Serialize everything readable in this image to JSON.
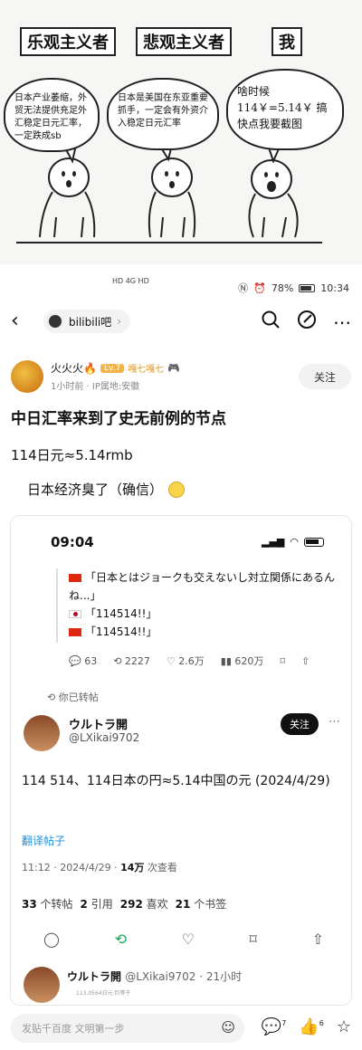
{
  "comic": {
    "labels": [
      "乐观主义者",
      "悲观主义者",
      "我"
    ],
    "bubbles": [
      "日本产业萎缩，外贸无法提供充足外汇稳定日元汇率，一定跌成sb",
      "日本是美国在东亚重要抓手，一定会有外资介入稳定日元汇率",
      "啥时候 114￥=5.14￥ 搞快点我要截图"
    ]
  },
  "status_bar": {
    "left": "HD 4G HD",
    "battery": "78%",
    "time": "10:34"
  },
  "nav": {
    "back_icon": "‹",
    "forum_name": "bilibili吧",
    "forum_chevron": "›"
  },
  "post": {
    "username": "火火火🔥",
    "level": "Lv.7",
    "badge": "嘎七嘎七",
    "meta": "1小时前 · IP属地:安徽",
    "follow": "关注",
    "title": "中日汇率来到了史无前例的节点",
    "line1": "114日元≈5.14rmb",
    "line2": "日本经济臭了（确信）"
  },
  "embed": {
    "time": "09:04",
    "quote_lines": [
      "「日本とはジョークも交えないし対立関係にあるんね...」",
      "「114514!!」",
      "「114514!!」"
    ],
    "stats": [
      "63",
      "2227",
      "2.6万",
      "620万"
    ],
    "repost_note": "你已转帖",
    "tweet_name": "ウルトラ開",
    "tweet_handle": "@LXikai9702",
    "tweet_follow": "关注",
    "tweet_body": "114 514、114日本の円≈5.14中国の元 (2024/4/29)",
    "translate": "翻译帖子",
    "tweet_meta_prefix": "11:12 · 2024/4/29 · ",
    "tweet_views": "14万",
    "tweet_meta_suffix": " 次查看",
    "counts": {
      "reposts": "33",
      "reposts_label": "个转帖",
      "quotes": "2",
      "quotes_label": "引用",
      "likes": "292",
      "likes_label": "喜欢",
      "bookmarks": "21",
      "bookmarks_label": "个书签"
    },
    "reply_name": "ウルトラ開",
    "reply_handle": "@LXikai9702 · 21小时",
    "reply_sub": "113.0564日元 约等于"
  },
  "bottom_bar": {
    "input_placeholder": "发贴千百度 文明第一步",
    "comment_count": "7",
    "like_count": "6"
  }
}
